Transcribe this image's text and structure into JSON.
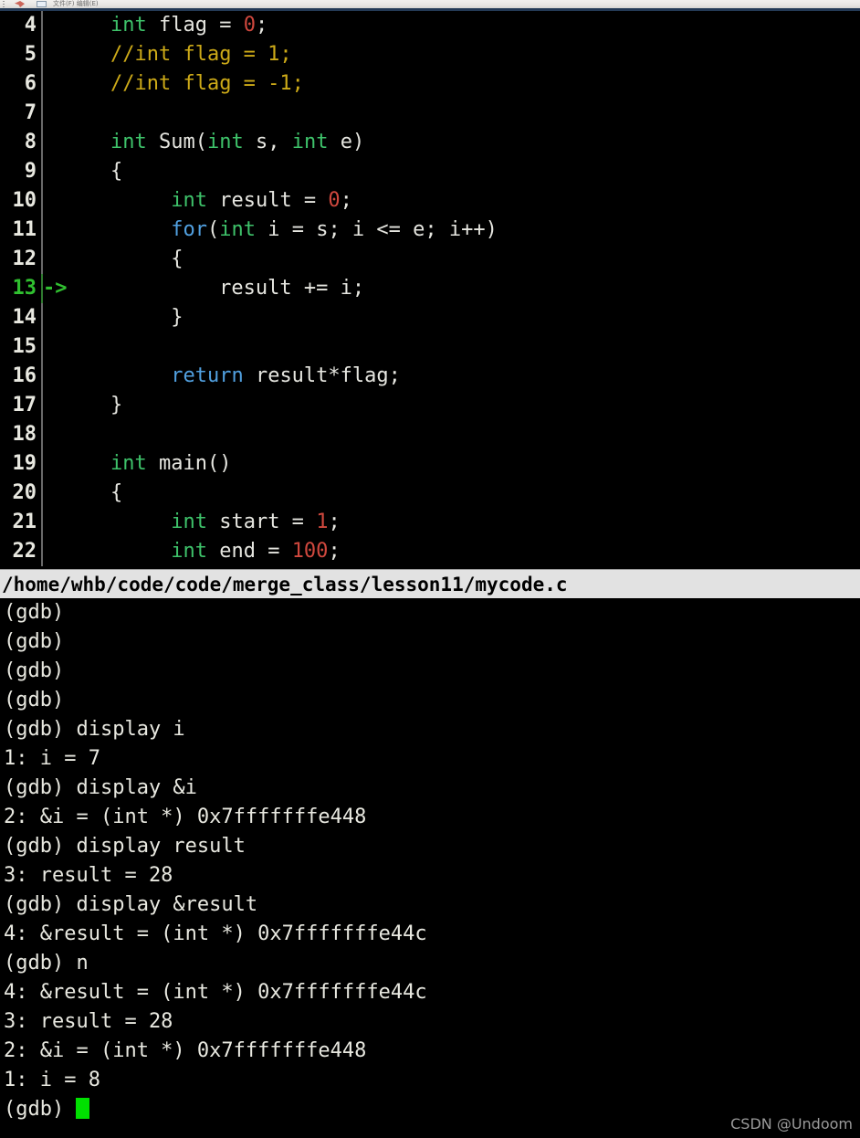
{
  "window": {
    "chrome_label": "文件(F) 编辑(E)",
    "accent_color": "#243a56"
  },
  "editor": {
    "background": "#000000",
    "current_line": 13,
    "current_line_marker": "->",
    "colors": {
      "keyword": "#51a0e0",
      "type": "#3ec26a",
      "number": "#d0483e",
      "comment": "#cdaa18",
      "text": "#e6e6e0",
      "current_line_green": "#30c030"
    },
    "lines": [
      {
        "num": "4",
        "current": false,
        "tokens": [
          {
            "t": "    ",
            "c": "pl"
          },
          {
            "t": "int",
            "c": "type"
          },
          {
            "t": " flag = ",
            "c": "pl"
          },
          {
            "t": "0",
            "c": "num"
          },
          {
            "t": ";",
            "c": "pl"
          }
        ]
      },
      {
        "num": "5",
        "current": false,
        "tokens": [
          {
            "t": "    ",
            "c": "pl"
          },
          {
            "t": "//int flag = 1;",
            "c": "com"
          }
        ]
      },
      {
        "num": "6",
        "current": false,
        "tokens": [
          {
            "t": "    ",
            "c": "pl"
          },
          {
            "t": "//int flag = -1;",
            "c": "com"
          }
        ]
      },
      {
        "num": "7",
        "current": false,
        "tokens": [
          {
            "t": "",
            "c": "pl"
          }
        ]
      },
      {
        "num": "8",
        "current": false,
        "tokens": [
          {
            "t": "    ",
            "c": "pl"
          },
          {
            "t": "int",
            "c": "type"
          },
          {
            "t": " Sum(",
            "c": "pl"
          },
          {
            "t": "int",
            "c": "type"
          },
          {
            "t": " s, ",
            "c": "pl"
          },
          {
            "t": "int",
            "c": "type"
          },
          {
            "t": " e)",
            "c": "pl"
          }
        ]
      },
      {
        "num": "9",
        "current": false,
        "tokens": [
          {
            "t": "    {",
            "c": "pl"
          }
        ]
      },
      {
        "num": "10",
        "current": false,
        "tokens": [
          {
            "t": "         ",
            "c": "pl"
          },
          {
            "t": "int",
            "c": "type"
          },
          {
            "t": " result = ",
            "c": "pl"
          },
          {
            "t": "0",
            "c": "num"
          },
          {
            "t": ";",
            "c": "pl"
          }
        ]
      },
      {
        "num": "11",
        "current": false,
        "tokens": [
          {
            "t": "         ",
            "c": "pl"
          },
          {
            "t": "for",
            "c": "kw"
          },
          {
            "t": "(",
            "c": "pl"
          },
          {
            "t": "int",
            "c": "type"
          },
          {
            "t": " i = s; i <= e; i++)",
            "c": "pl"
          }
        ]
      },
      {
        "num": "12",
        "current": false,
        "tokens": [
          {
            "t": "         {",
            "c": "pl"
          }
        ]
      },
      {
        "num": "13",
        "current": true,
        "tokens": [
          {
            "t": "             result += i;",
            "c": "pl"
          }
        ]
      },
      {
        "num": "14",
        "current": false,
        "tokens": [
          {
            "t": "         }",
            "c": "pl"
          }
        ]
      },
      {
        "num": "15",
        "current": false,
        "tokens": [
          {
            "t": "",
            "c": "pl"
          }
        ]
      },
      {
        "num": "16",
        "current": false,
        "tokens": [
          {
            "t": "         ",
            "c": "pl"
          },
          {
            "t": "return",
            "c": "kw"
          },
          {
            "t": " result*flag;",
            "c": "pl"
          }
        ]
      },
      {
        "num": "17",
        "current": false,
        "tokens": [
          {
            "t": "    }",
            "c": "pl"
          }
        ]
      },
      {
        "num": "18",
        "current": false,
        "tokens": [
          {
            "t": "",
            "c": "pl"
          }
        ]
      },
      {
        "num": "19",
        "current": false,
        "tokens": [
          {
            "t": "    ",
            "c": "pl"
          },
          {
            "t": "int",
            "c": "type"
          },
          {
            "t": " main()",
            "c": "pl"
          }
        ]
      },
      {
        "num": "20",
        "current": false,
        "tokens": [
          {
            "t": "    {",
            "c": "pl"
          }
        ]
      },
      {
        "num": "21",
        "current": false,
        "tokens": [
          {
            "t": "         ",
            "c": "pl"
          },
          {
            "t": "int",
            "c": "type"
          },
          {
            "t": " start = ",
            "c": "pl"
          },
          {
            "t": "1",
            "c": "num"
          },
          {
            "t": ";",
            "c": "pl"
          }
        ]
      },
      {
        "num": "22",
        "current": false,
        "tokens": [
          {
            "t": "         ",
            "c": "pl"
          },
          {
            "t": "int",
            "c": "type"
          },
          {
            "t": " end = ",
            "c": "pl"
          },
          {
            "t": "100",
            "c": "num"
          },
          {
            "t": ";",
            "c": "pl"
          }
        ]
      }
    ]
  },
  "pathbar": {
    "path": "/home/whb/code/code/merge_class/lesson11/mycode.c",
    "background": "#e2e2e2",
    "foreground": "#000000"
  },
  "console": {
    "prompt": "(gdb)",
    "cursor_color": "#00e000",
    "lines": [
      "(gdb)",
      "(gdb)",
      "(gdb)",
      "(gdb)",
      "(gdb) display i",
      "1: i = 7",
      "(gdb) display &i",
      "2: &i = (int *) 0x7fffffffe448",
      "(gdb) display result",
      "3: result = 28",
      "(gdb) display &result",
      "4: &result = (int *) 0x7fffffffe44c",
      "(gdb) n",
      "4: &result = (int *) 0x7fffffffe44c",
      "3: result = 28",
      "2: &i = (int *) 0x7fffffffe448",
      "1: i = 8"
    ],
    "last_prompt": "(gdb) "
  },
  "watermark": {
    "text": "CSDN @Undoom"
  }
}
